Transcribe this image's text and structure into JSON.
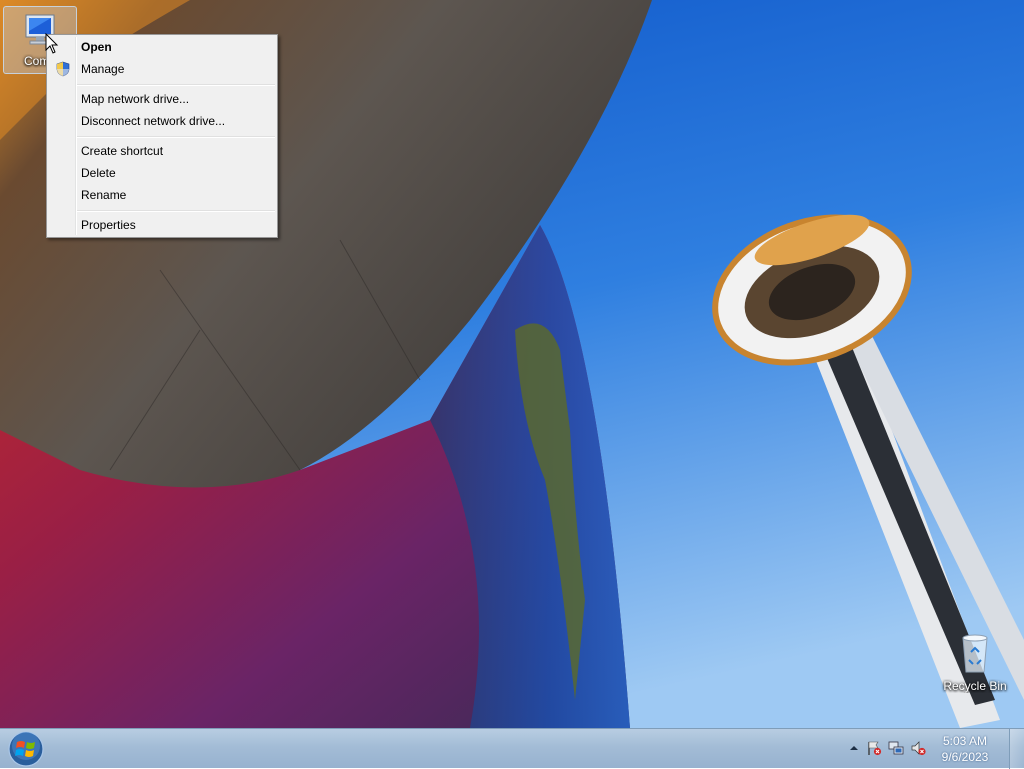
{
  "desktop": {
    "icons": [
      {
        "label": "Comp",
        "icon": "computer-icon"
      },
      {
        "label": "Recycle Bin",
        "icon": "recycle-bin-icon"
      }
    ]
  },
  "context_menu": {
    "items": [
      {
        "label": "Open",
        "bold": true
      },
      {
        "label": "Manage",
        "icon": "uac-shield-icon"
      },
      {
        "label": "Map network drive..."
      },
      {
        "label": "Disconnect network drive..."
      },
      {
        "label": "Create shortcut"
      },
      {
        "label": "Delete"
      },
      {
        "label": "Rename"
      },
      {
        "label": "Properties"
      }
    ]
  },
  "taskbar": {
    "start_icon": "windows-logo-icon",
    "tray": {
      "icons": [
        "show-hidden-icons-arrow",
        "action-center-flag-icon",
        "network-icon",
        "volume-muted-icon"
      ],
      "time": "5:03 AM",
      "date": "9/6/2023"
    }
  },
  "colors": {
    "menu_bg": "#f0f0f0",
    "taskbar": "#a3bcd6",
    "sky": "#1f6fd4"
  }
}
